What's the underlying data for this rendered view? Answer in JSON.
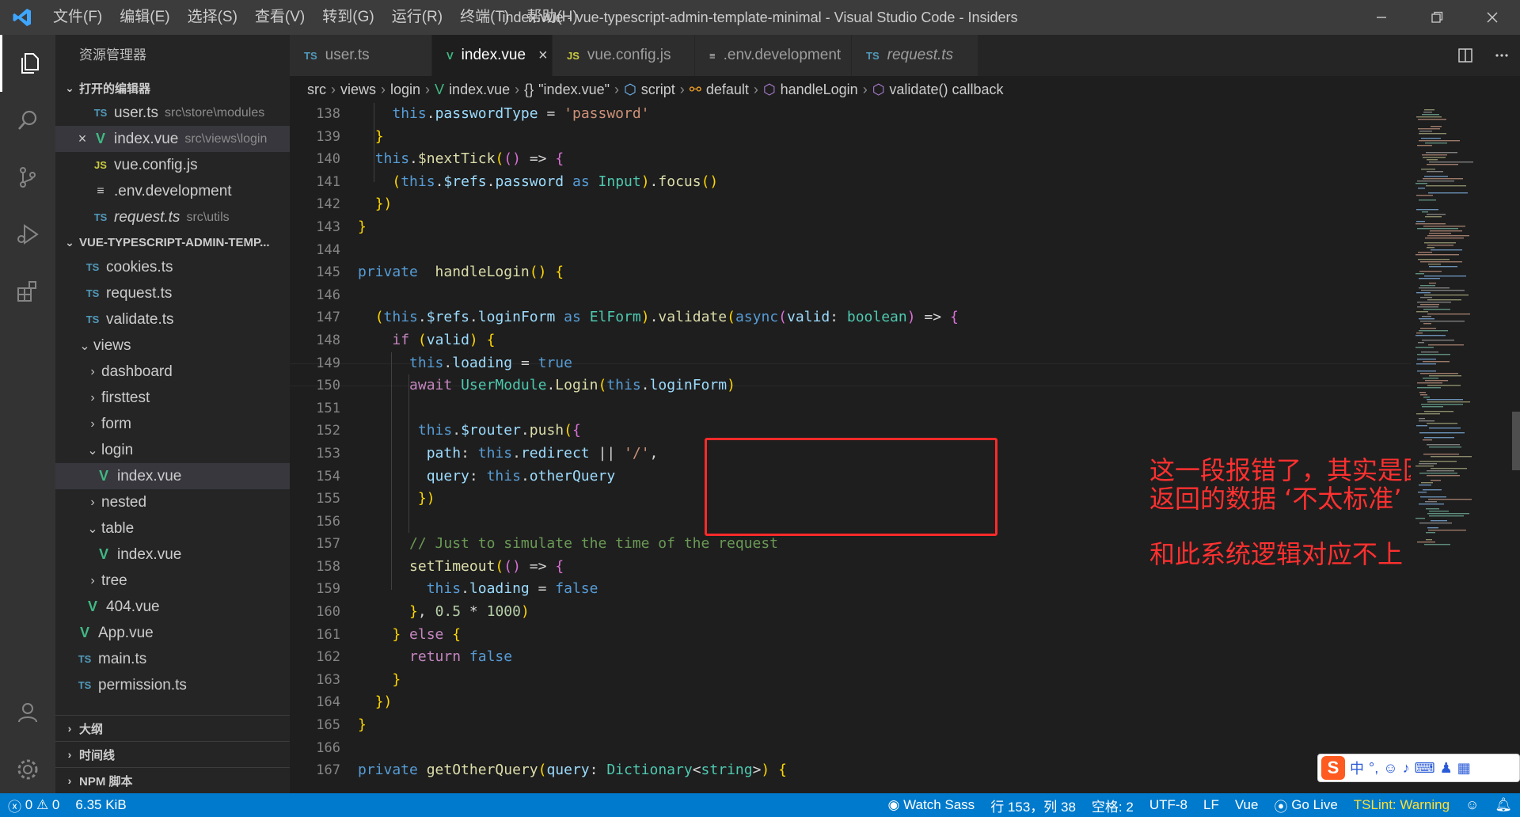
{
  "window": {
    "title": "index.vue - vue-typescript-admin-template-minimal - Visual Studio Code - Insiders",
    "menu": [
      "文件(F)",
      "编辑(E)",
      "选择(S)",
      "查看(V)",
      "转到(G)",
      "运行(R)",
      "终端(T)",
      "帮助(H)"
    ]
  },
  "sidebar": {
    "title": "资源管理器",
    "open_editors_label": "打开的编辑器",
    "open_editors": [
      {
        "icon": "TS",
        "name": "user.ts",
        "desc": "src\\store\\modules"
      },
      {
        "icon": "V",
        "name": "index.vue",
        "desc": "src\\views\\login"
      },
      {
        "icon": "JS",
        "name": "vue.config.js",
        "desc": ""
      },
      {
        "icon": "≡",
        "name": ".env.development",
        "desc": ""
      },
      {
        "icon": "TS",
        "name": "request.ts",
        "desc": "src\\utils"
      }
    ],
    "project_label": "VUE-TYPESCRIPT-ADMIN-TEMP...",
    "tree": [
      {
        "icon": "TS",
        "name": "cookies.ts"
      },
      {
        "icon": "TS",
        "name": "request.ts"
      },
      {
        "icon": "TS",
        "name": "validate.ts"
      },
      {
        "icon": "",
        "name": "views"
      },
      {
        "icon": "",
        "name": "dashboard"
      },
      {
        "icon": "",
        "name": "firsttest"
      },
      {
        "icon": "",
        "name": "form"
      },
      {
        "icon": "",
        "name": "login"
      },
      {
        "icon": "V",
        "name": "index.vue"
      },
      {
        "icon": "",
        "name": "nested"
      },
      {
        "icon": "",
        "name": "table"
      },
      {
        "icon": "V",
        "name": "index.vue"
      },
      {
        "icon": "",
        "name": "tree"
      },
      {
        "icon": "V",
        "name": "404.vue"
      },
      {
        "icon": "V",
        "name": "App.vue"
      },
      {
        "icon": "TS",
        "name": "main.ts"
      },
      {
        "icon": "TS",
        "name": "permission.ts"
      }
    ],
    "bottom_sections": [
      "大纲",
      "时间线",
      "NPM 脚本"
    ]
  },
  "tabs": [
    {
      "icon": "TS",
      "label": "user.ts"
    },
    {
      "icon": "V",
      "label": "index.vue"
    },
    {
      "icon": "JS",
      "label": "vue.config.js"
    },
    {
      "icon": "≡",
      "label": ".env.development"
    },
    {
      "icon": "TS",
      "label": "request.ts"
    }
  ],
  "breadcrumb": [
    "src",
    "views",
    "login",
    "index.vue",
    "\"index.vue\"",
    "script",
    "default",
    "handleLogin",
    "validate() callback"
  ],
  "editor": {
    "line_numbers": [
      "138",
      "139",
      "140",
      "141",
      "142",
      "143",
      "144",
      "145",
      "146",
      "147",
      "148",
      "149",
      "150",
      "151",
      "152",
      "153",
      "154",
      "155",
      "156",
      "157",
      "158",
      "159",
      "160",
      "161",
      "162",
      "163",
      "164",
      "165",
      "166",
      "167"
    ],
    "code_lines": [
      "    this.passwordType = 'password'",
      "  }",
      "  this.$nextTick(() => {",
      "    (this.$refs.password as Input).focus()",
      "  })",
      "}",
      "",
      "private  handleLogin() {",
      "",
      "  (this.$refs.loginForm as ElForm).validate(async(valid: boolean) => {",
      "    if (valid) {",
      "      this.loading = true",
      "      await UserModule.Login(this.loginForm)",
      "",
      "       this.$router.push({",
      "        path: this.redirect || '/',",
      "        query: this.otherQuery",
      "       })",
      "",
      "      // Just to simulate the time of the request",
      "      setTimeout(() => {",
      "        this.loading = false",
      "      }, 0.5 * 1000)",
      "    } else {",
      "      return false",
      "    }",
      "  })",
      "}",
      "",
      "private getOtherQuery(query: Dictionary<string>) {"
    ],
    "annotation": {
      "line1": "这一段报错了，其实是因为我们改的接口",
      "line2": "返回的数据 ‘不太标准’",
      "line3": "和此系统逻辑对应不上"
    }
  },
  "ime": {
    "label": "中"
  },
  "statusbar": {
    "errors": "0",
    "warnings": "0",
    "file_size": "6.35 KiB",
    "watch_sass": "Watch Sass",
    "position": "行 153，列 38",
    "spaces": "空格: 2",
    "encoding": "UTF-8",
    "eol": "LF",
    "language": "Vue",
    "go_live": "Go Live",
    "tslint": "TSLint: Warning"
  },
  "colors": {
    "accent": "#007acc",
    "annotation": "#ff3030",
    "box": "#ff2a2a"
  }
}
